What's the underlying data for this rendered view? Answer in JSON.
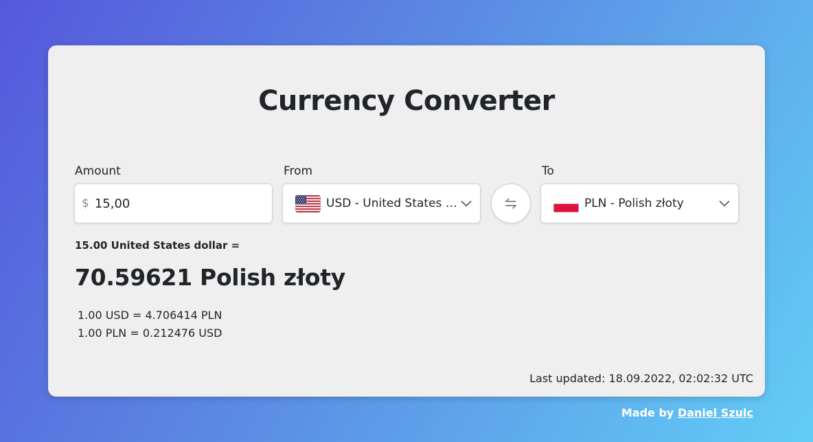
{
  "app": {
    "title": "Currency Converter"
  },
  "amount": {
    "label": "Amount",
    "currency_symbol": "$",
    "value": "15,00"
  },
  "from": {
    "label": "From",
    "selected": "USD - United States dollar",
    "flag": "us-flag"
  },
  "to": {
    "label": "To",
    "selected": "PLN - Polish złoty",
    "flag": "pl-flag"
  },
  "swap": {
    "icon": "swap-arrows-icon"
  },
  "result": {
    "from_text": "15.00 United States dollar =",
    "to_text": "70.59621 Polish złoty",
    "rate_forward": "1.00 USD = 4.706414 PLN",
    "rate_reverse": "1.00 PLN = 0.212476 USD"
  },
  "last_updated": "Last updated: 18.09.2022, 02:02:32 UTC",
  "footer": {
    "prefix": "Made by",
    "author": "Daniel Szulc"
  },
  "colors": {
    "card_bg": "#efefef",
    "text": "#212529",
    "gradient_start": "#5558dc",
    "gradient_end": "#62cdf6"
  }
}
